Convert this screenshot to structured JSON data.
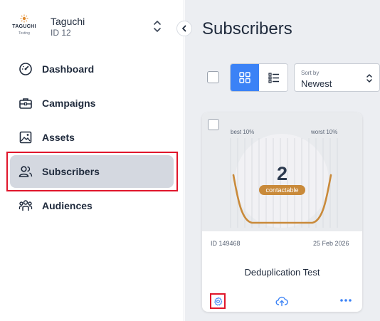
{
  "account": {
    "logo_text": "TAGUCHI",
    "logo_sub": "Testing",
    "name": "Taguchi",
    "id_label": "ID 12"
  },
  "sidebar": {
    "items": [
      {
        "label": "Dashboard",
        "icon": "gauge-icon"
      },
      {
        "label": "Campaigns",
        "icon": "briefcase-icon"
      },
      {
        "label": "Assets",
        "icon": "image-icon"
      },
      {
        "label": "Subscribers",
        "icon": "users-icon",
        "active": true
      },
      {
        "label": "Audiences",
        "icon": "group-icon"
      }
    ]
  },
  "main": {
    "title": "Subscribers",
    "sort": {
      "caption": "Sort by",
      "value": "Newest"
    },
    "card": {
      "best_label": "best 10%",
      "worst_label": "worst 10%",
      "count": "2",
      "count_label": "contactable",
      "id_label": "ID 149468",
      "date": "25 Feb 2026",
      "name": "Deduplication Test"
    }
  },
  "colors": {
    "accent": "#3b82f6",
    "active_nav": "#d4d8e0",
    "highlight": "#e0162b",
    "curve": "#c98a3a",
    "main_bg": "#eceef2"
  }
}
